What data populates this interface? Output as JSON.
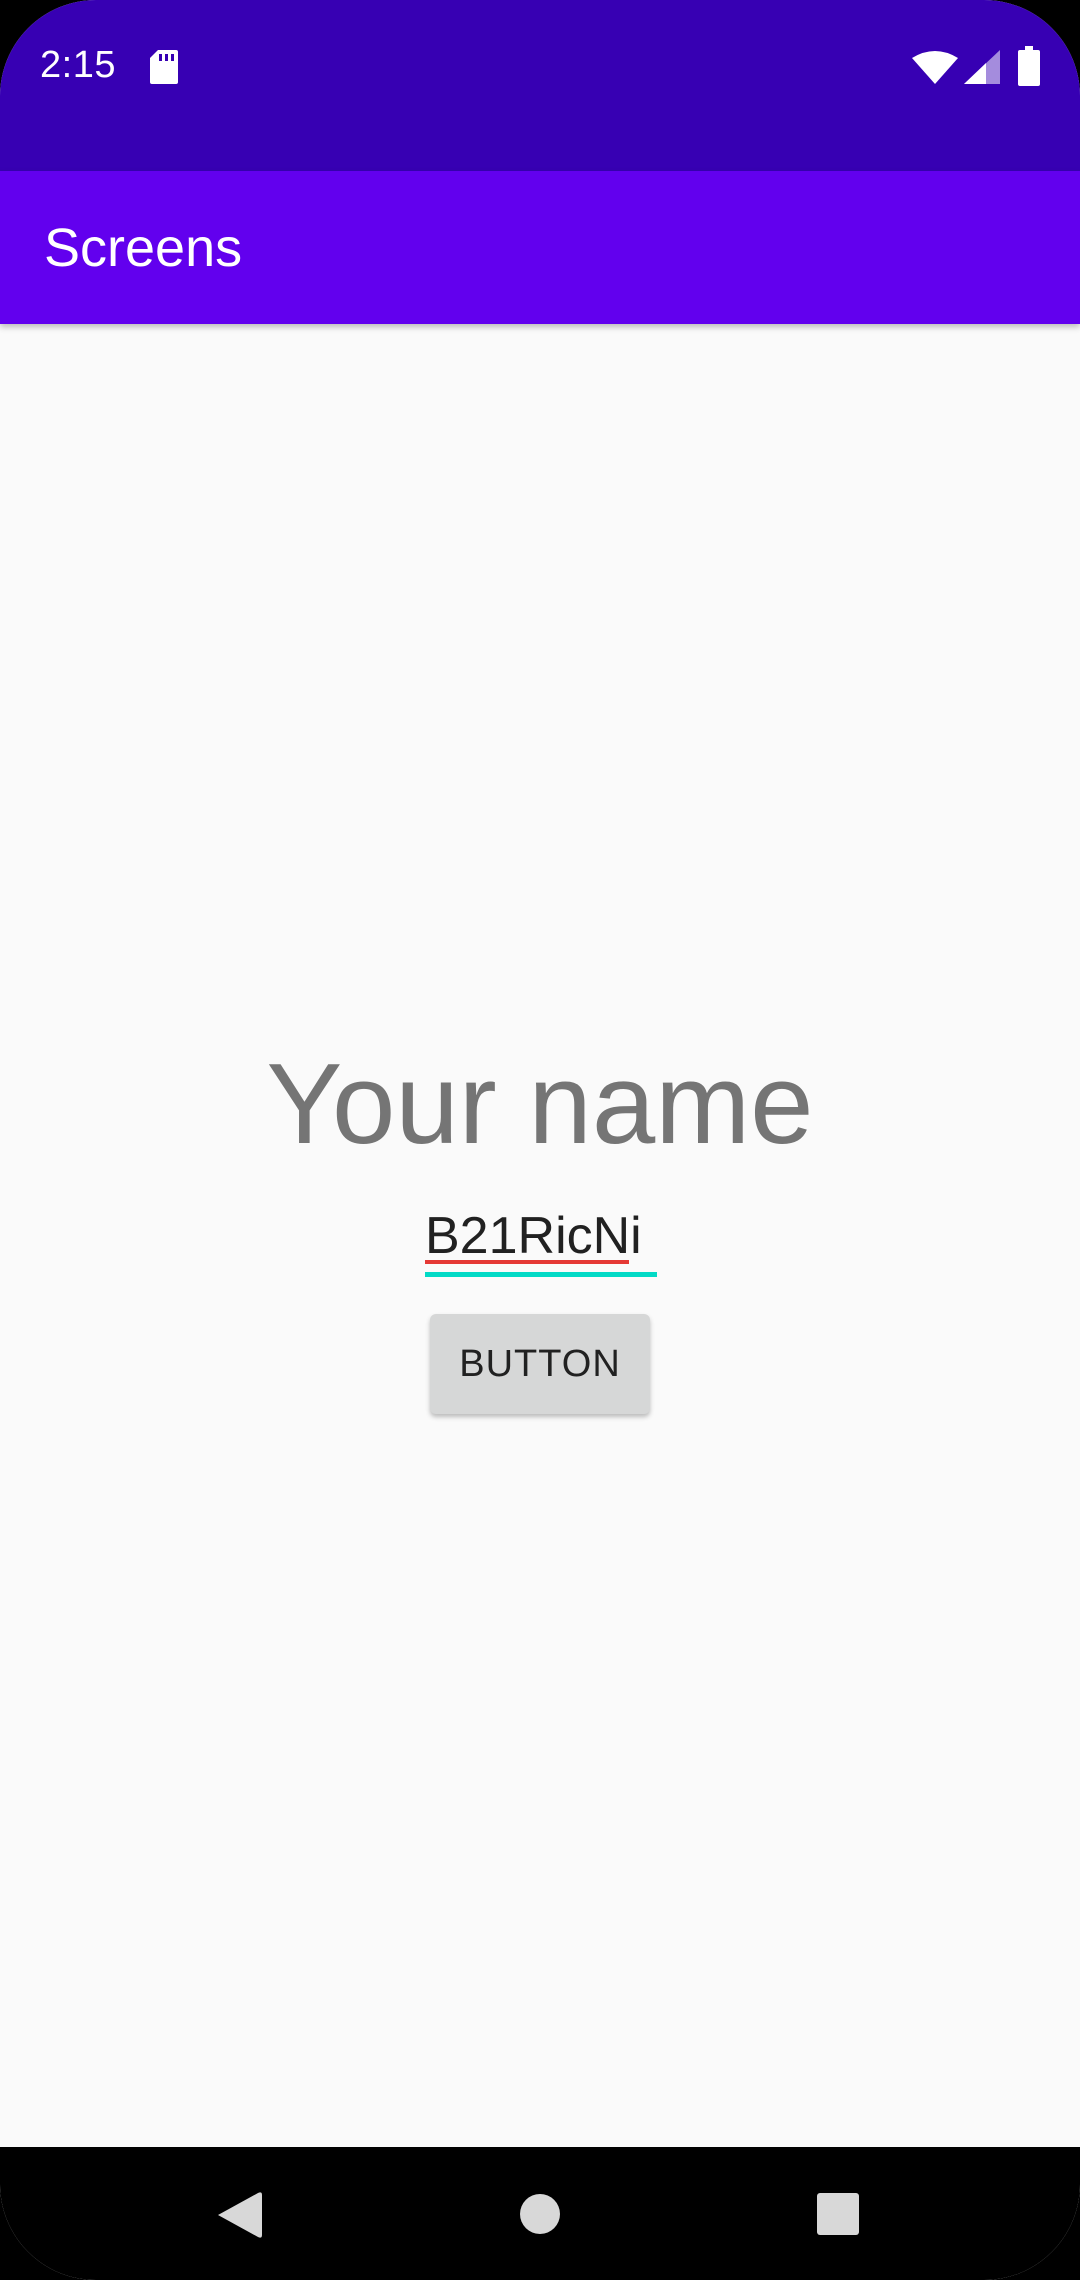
{
  "status_bar": {
    "time": "2:15",
    "icons": [
      "sd-card-icon",
      "wifi-icon",
      "cell-signal-icon",
      "battery-icon"
    ],
    "color": "#3700b3"
  },
  "app_bar": {
    "title": "Screens",
    "color": "#6200ee"
  },
  "main": {
    "heading": "Your name",
    "name_field": {
      "value": "B21RicNi",
      "underline_color": "#03dac6"
    },
    "button_label": "BUTTON"
  },
  "nav_bar": {
    "icons": [
      "back-icon",
      "home-icon",
      "recents-icon"
    ]
  }
}
